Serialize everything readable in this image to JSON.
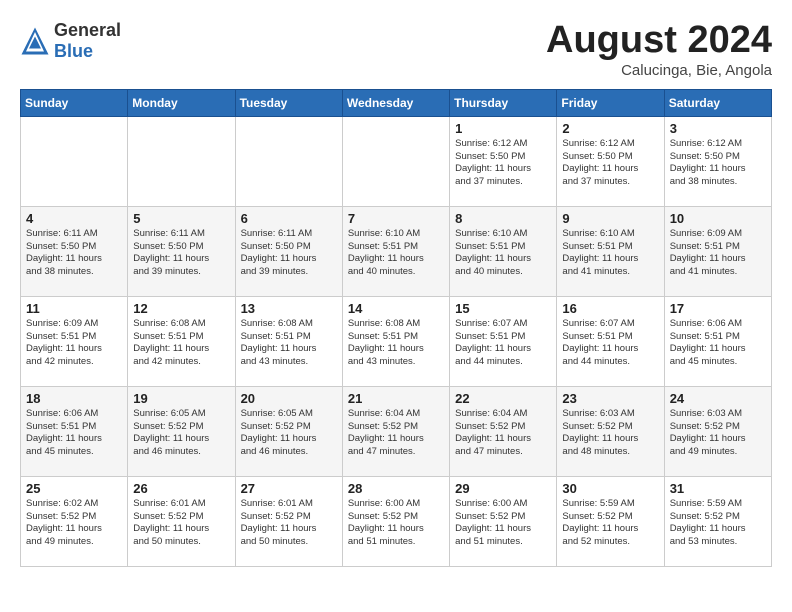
{
  "header": {
    "logo_general": "General",
    "logo_blue": "Blue",
    "title": "August 2024",
    "location": "Calucinga, Bie, Angola"
  },
  "days_of_week": [
    "Sunday",
    "Monday",
    "Tuesday",
    "Wednesday",
    "Thursday",
    "Friday",
    "Saturday"
  ],
  "weeks": [
    [
      {
        "day": "",
        "info": ""
      },
      {
        "day": "",
        "info": ""
      },
      {
        "day": "",
        "info": ""
      },
      {
        "day": "",
        "info": ""
      },
      {
        "day": "1",
        "info": "Sunrise: 6:12 AM\nSunset: 5:50 PM\nDaylight: 11 hours\nand 37 minutes."
      },
      {
        "day": "2",
        "info": "Sunrise: 6:12 AM\nSunset: 5:50 PM\nDaylight: 11 hours\nand 37 minutes."
      },
      {
        "day": "3",
        "info": "Sunrise: 6:12 AM\nSunset: 5:50 PM\nDaylight: 11 hours\nand 38 minutes."
      }
    ],
    [
      {
        "day": "4",
        "info": "Sunrise: 6:11 AM\nSunset: 5:50 PM\nDaylight: 11 hours\nand 38 minutes."
      },
      {
        "day": "5",
        "info": "Sunrise: 6:11 AM\nSunset: 5:50 PM\nDaylight: 11 hours\nand 39 minutes."
      },
      {
        "day": "6",
        "info": "Sunrise: 6:11 AM\nSunset: 5:50 PM\nDaylight: 11 hours\nand 39 minutes."
      },
      {
        "day": "7",
        "info": "Sunrise: 6:10 AM\nSunset: 5:51 PM\nDaylight: 11 hours\nand 40 minutes."
      },
      {
        "day": "8",
        "info": "Sunrise: 6:10 AM\nSunset: 5:51 PM\nDaylight: 11 hours\nand 40 minutes."
      },
      {
        "day": "9",
        "info": "Sunrise: 6:10 AM\nSunset: 5:51 PM\nDaylight: 11 hours\nand 41 minutes."
      },
      {
        "day": "10",
        "info": "Sunrise: 6:09 AM\nSunset: 5:51 PM\nDaylight: 11 hours\nand 41 minutes."
      }
    ],
    [
      {
        "day": "11",
        "info": "Sunrise: 6:09 AM\nSunset: 5:51 PM\nDaylight: 11 hours\nand 42 minutes."
      },
      {
        "day": "12",
        "info": "Sunrise: 6:08 AM\nSunset: 5:51 PM\nDaylight: 11 hours\nand 42 minutes."
      },
      {
        "day": "13",
        "info": "Sunrise: 6:08 AM\nSunset: 5:51 PM\nDaylight: 11 hours\nand 43 minutes."
      },
      {
        "day": "14",
        "info": "Sunrise: 6:08 AM\nSunset: 5:51 PM\nDaylight: 11 hours\nand 43 minutes."
      },
      {
        "day": "15",
        "info": "Sunrise: 6:07 AM\nSunset: 5:51 PM\nDaylight: 11 hours\nand 44 minutes."
      },
      {
        "day": "16",
        "info": "Sunrise: 6:07 AM\nSunset: 5:51 PM\nDaylight: 11 hours\nand 44 minutes."
      },
      {
        "day": "17",
        "info": "Sunrise: 6:06 AM\nSunset: 5:51 PM\nDaylight: 11 hours\nand 45 minutes."
      }
    ],
    [
      {
        "day": "18",
        "info": "Sunrise: 6:06 AM\nSunset: 5:51 PM\nDaylight: 11 hours\nand 45 minutes."
      },
      {
        "day": "19",
        "info": "Sunrise: 6:05 AM\nSunset: 5:52 PM\nDaylight: 11 hours\nand 46 minutes."
      },
      {
        "day": "20",
        "info": "Sunrise: 6:05 AM\nSunset: 5:52 PM\nDaylight: 11 hours\nand 46 minutes."
      },
      {
        "day": "21",
        "info": "Sunrise: 6:04 AM\nSunset: 5:52 PM\nDaylight: 11 hours\nand 47 minutes."
      },
      {
        "day": "22",
        "info": "Sunrise: 6:04 AM\nSunset: 5:52 PM\nDaylight: 11 hours\nand 47 minutes."
      },
      {
        "day": "23",
        "info": "Sunrise: 6:03 AM\nSunset: 5:52 PM\nDaylight: 11 hours\nand 48 minutes."
      },
      {
        "day": "24",
        "info": "Sunrise: 6:03 AM\nSunset: 5:52 PM\nDaylight: 11 hours\nand 49 minutes."
      }
    ],
    [
      {
        "day": "25",
        "info": "Sunrise: 6:02 AM\nSunset: 5:52 PM\nDaylight: 11 hours\nand 49 minutes."
      },
      {
        "day": "26",
        "info": "Sunrise: 6:01 AM\nSunset: 5:52 PM\nDaylight: 11 hours\nand 50 minutes."
      },
      {
        "day": "27",
        "info": "Sunrise: 6:01 AM\nSunset: 5:52 PM\nDaylight: 11 hours\nand 50 minutes."
      },
      {
        "day": "28",
        "info": "Sunrise: 6:00 AM\nSunset: 5:52 PM\nDaylight: 11 hours\nand 51 minutes."
      },
      {
        "day": "29",
        "info": "Sunrise: 6:00 AM\nSunset: 5:52 PM\nDaylight: 11 hours\nand 51 minutes."
      },
      {
        "day": "30",
        "info": "Sunrise: 5:59 AM\nSunset: 5:52 PM\nDaylight: 11 hours\nand 52 minutes."
      },
      {
        "day": "31",
        "info": "Sunrise: 5:59 AM\nSunset: 5:52 PM\nDaylight: 11 hours\nand 53 minutes."
      }
    ]
  ]
}
